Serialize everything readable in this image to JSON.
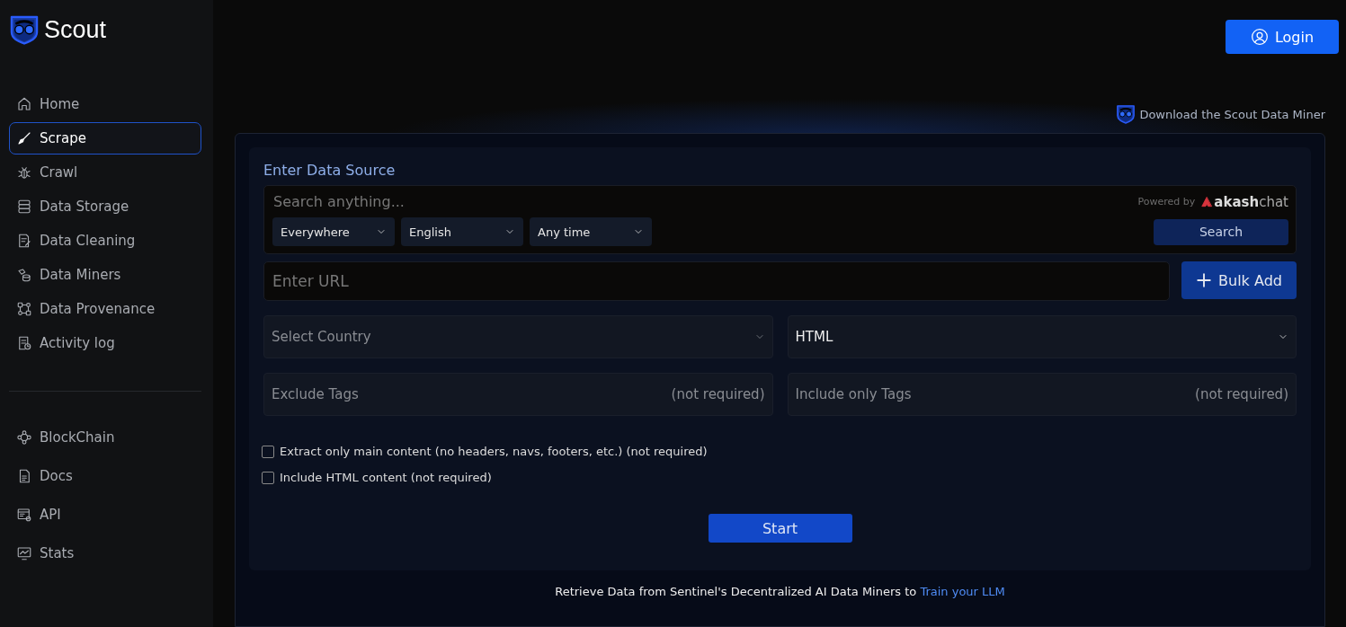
{
  "brand": {
    "name": "Scout"
  },
  "sidebar": {
    "items": [
      {
        "label": "Home",
        "selected": false
      },
      {
        "label": "Scrape",
        "selected": true
      },
      {
        "label": "Crawl",
        "selected": false
      },
      {
        "label": "Data Storage",
        "selected": false
      },
      {
        "label": "Data Cleaning",
        "selected": false
      },
      {
        "label": "Data Miners",
        "selected": false
      },
      {
        "label": "Data Provenance",
        "selected": false
      },
      {
        "label": "Activity log",
        "selected": false
      }
    ],
    "secondary_items": [
      {
        "label": "BlockChain",
        "selected": false
      },
      {
        "label": "Docs",
        "selected": false
      },
      {
        "label": "API",
        "selected": false
      },
      {
        "label": "Stats",
        "selected": false
      }
    ]
  },
  "header": {
    "login_button": "Login",
    "download_link": "Download the Scout Data Miner"
  },
  "form": {
    "title": "Enter Data Source",
    "search": {
      "placeholder": "Search anything...",
      "powered_by": "Powered by",
      "provider": "**akash**chat",
      "button": "Search"
    },
    "filters": [
      {
        "value": "Everywhere"
      },
      {
        "value": "English"
      },
      {
        "value": "Any time"
      }
    ],
    "url": {
      "placeholder": "Enter URL",
      "bulk_button": "Bulk Add"
    },
    "country": {
      "placeholder": "Select Country"
    },
    "format": {
      "value": "HTML"
    },
    "exclude_tags": {
      "placeholder": "Exclude Tags",
      "hint": "(not required)"
    },
    "include_tags": {
      "placeholder": "Include only Tags",
      "hint": "(not required)"
    },
    "options": [
      {
        "label": "Extract only main content (no headers, navs, footers, etc.) (not required)",
        "checked": false
      },
      {
        "label": "Include HTML content (not required)",
        "checked": false
      }
    ],
    "start_button": "Start"
  },
  "footer": {
    "text": "Retrieve Data from Sentinel's Decentralized AI Data Miners to",
    "link": "Train your LLM"
  }
}
